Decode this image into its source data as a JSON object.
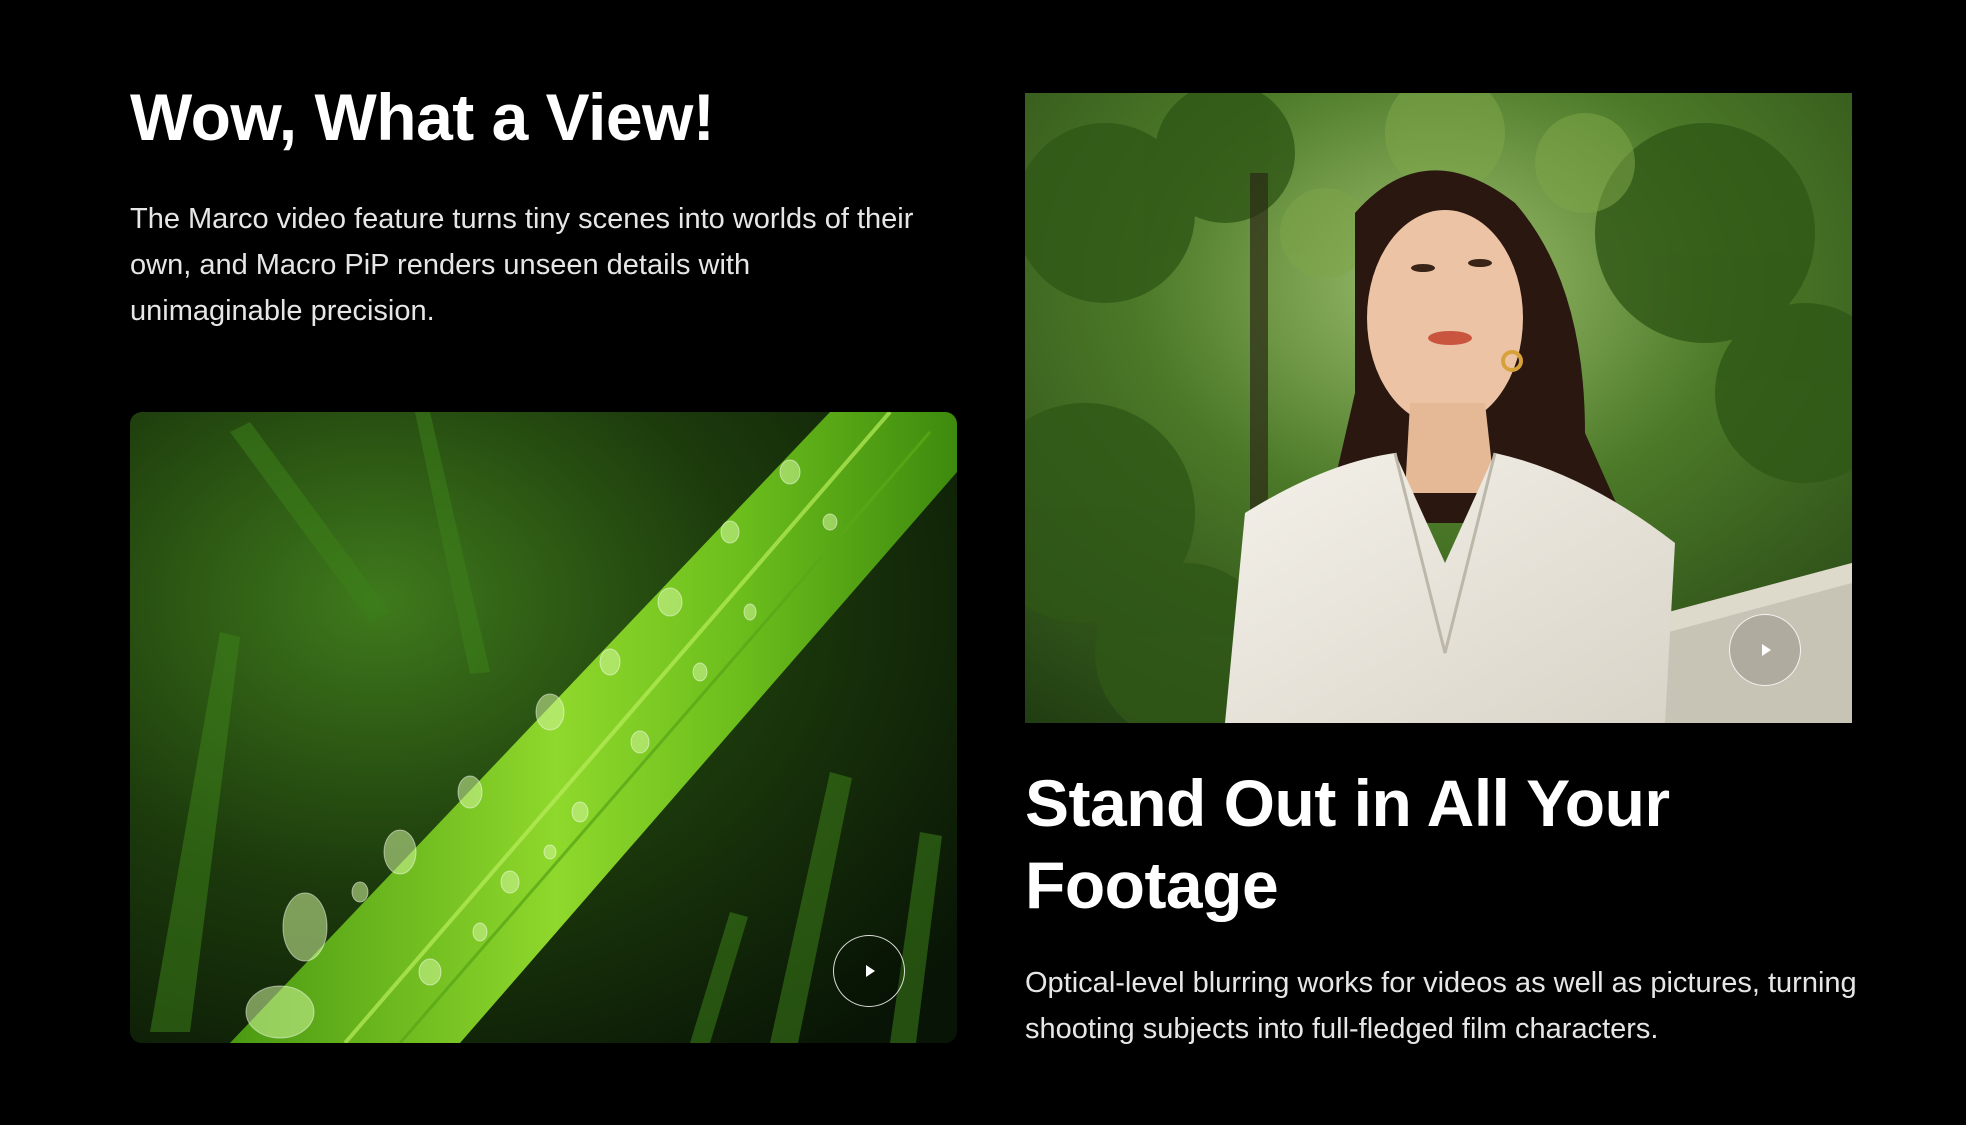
{
  "section_one": {
    "title": "Wow, What a View!",
    "description": "The Marco video feature turns tiny scenes into worlds of their own, and Macro PiP renders unseen details with unimaginable precision.",
    "media": {
      "subject": "leaf-with-water-droplets",
      "play_icon": "play-icon"
    }
  },
  "section_two": {
    "title": "Stand Out in All Your Footage",
    "description": "Optical-level blurring works for videos as well as pictures, turning shooting subjects into full-fledged film characters.",
    "media": {
      "subject": "woman-portrait-in-garden",
      "play_icon": "play-icon"
    }
  },
  "colors": {
    "background": "#000000",
    "heading": "#ffffff",
    "body_text": "#e6e6e6",
    "leaf_green": "#6fc21e",
    "foliage_dark": "#1f3a10"
  }
}
